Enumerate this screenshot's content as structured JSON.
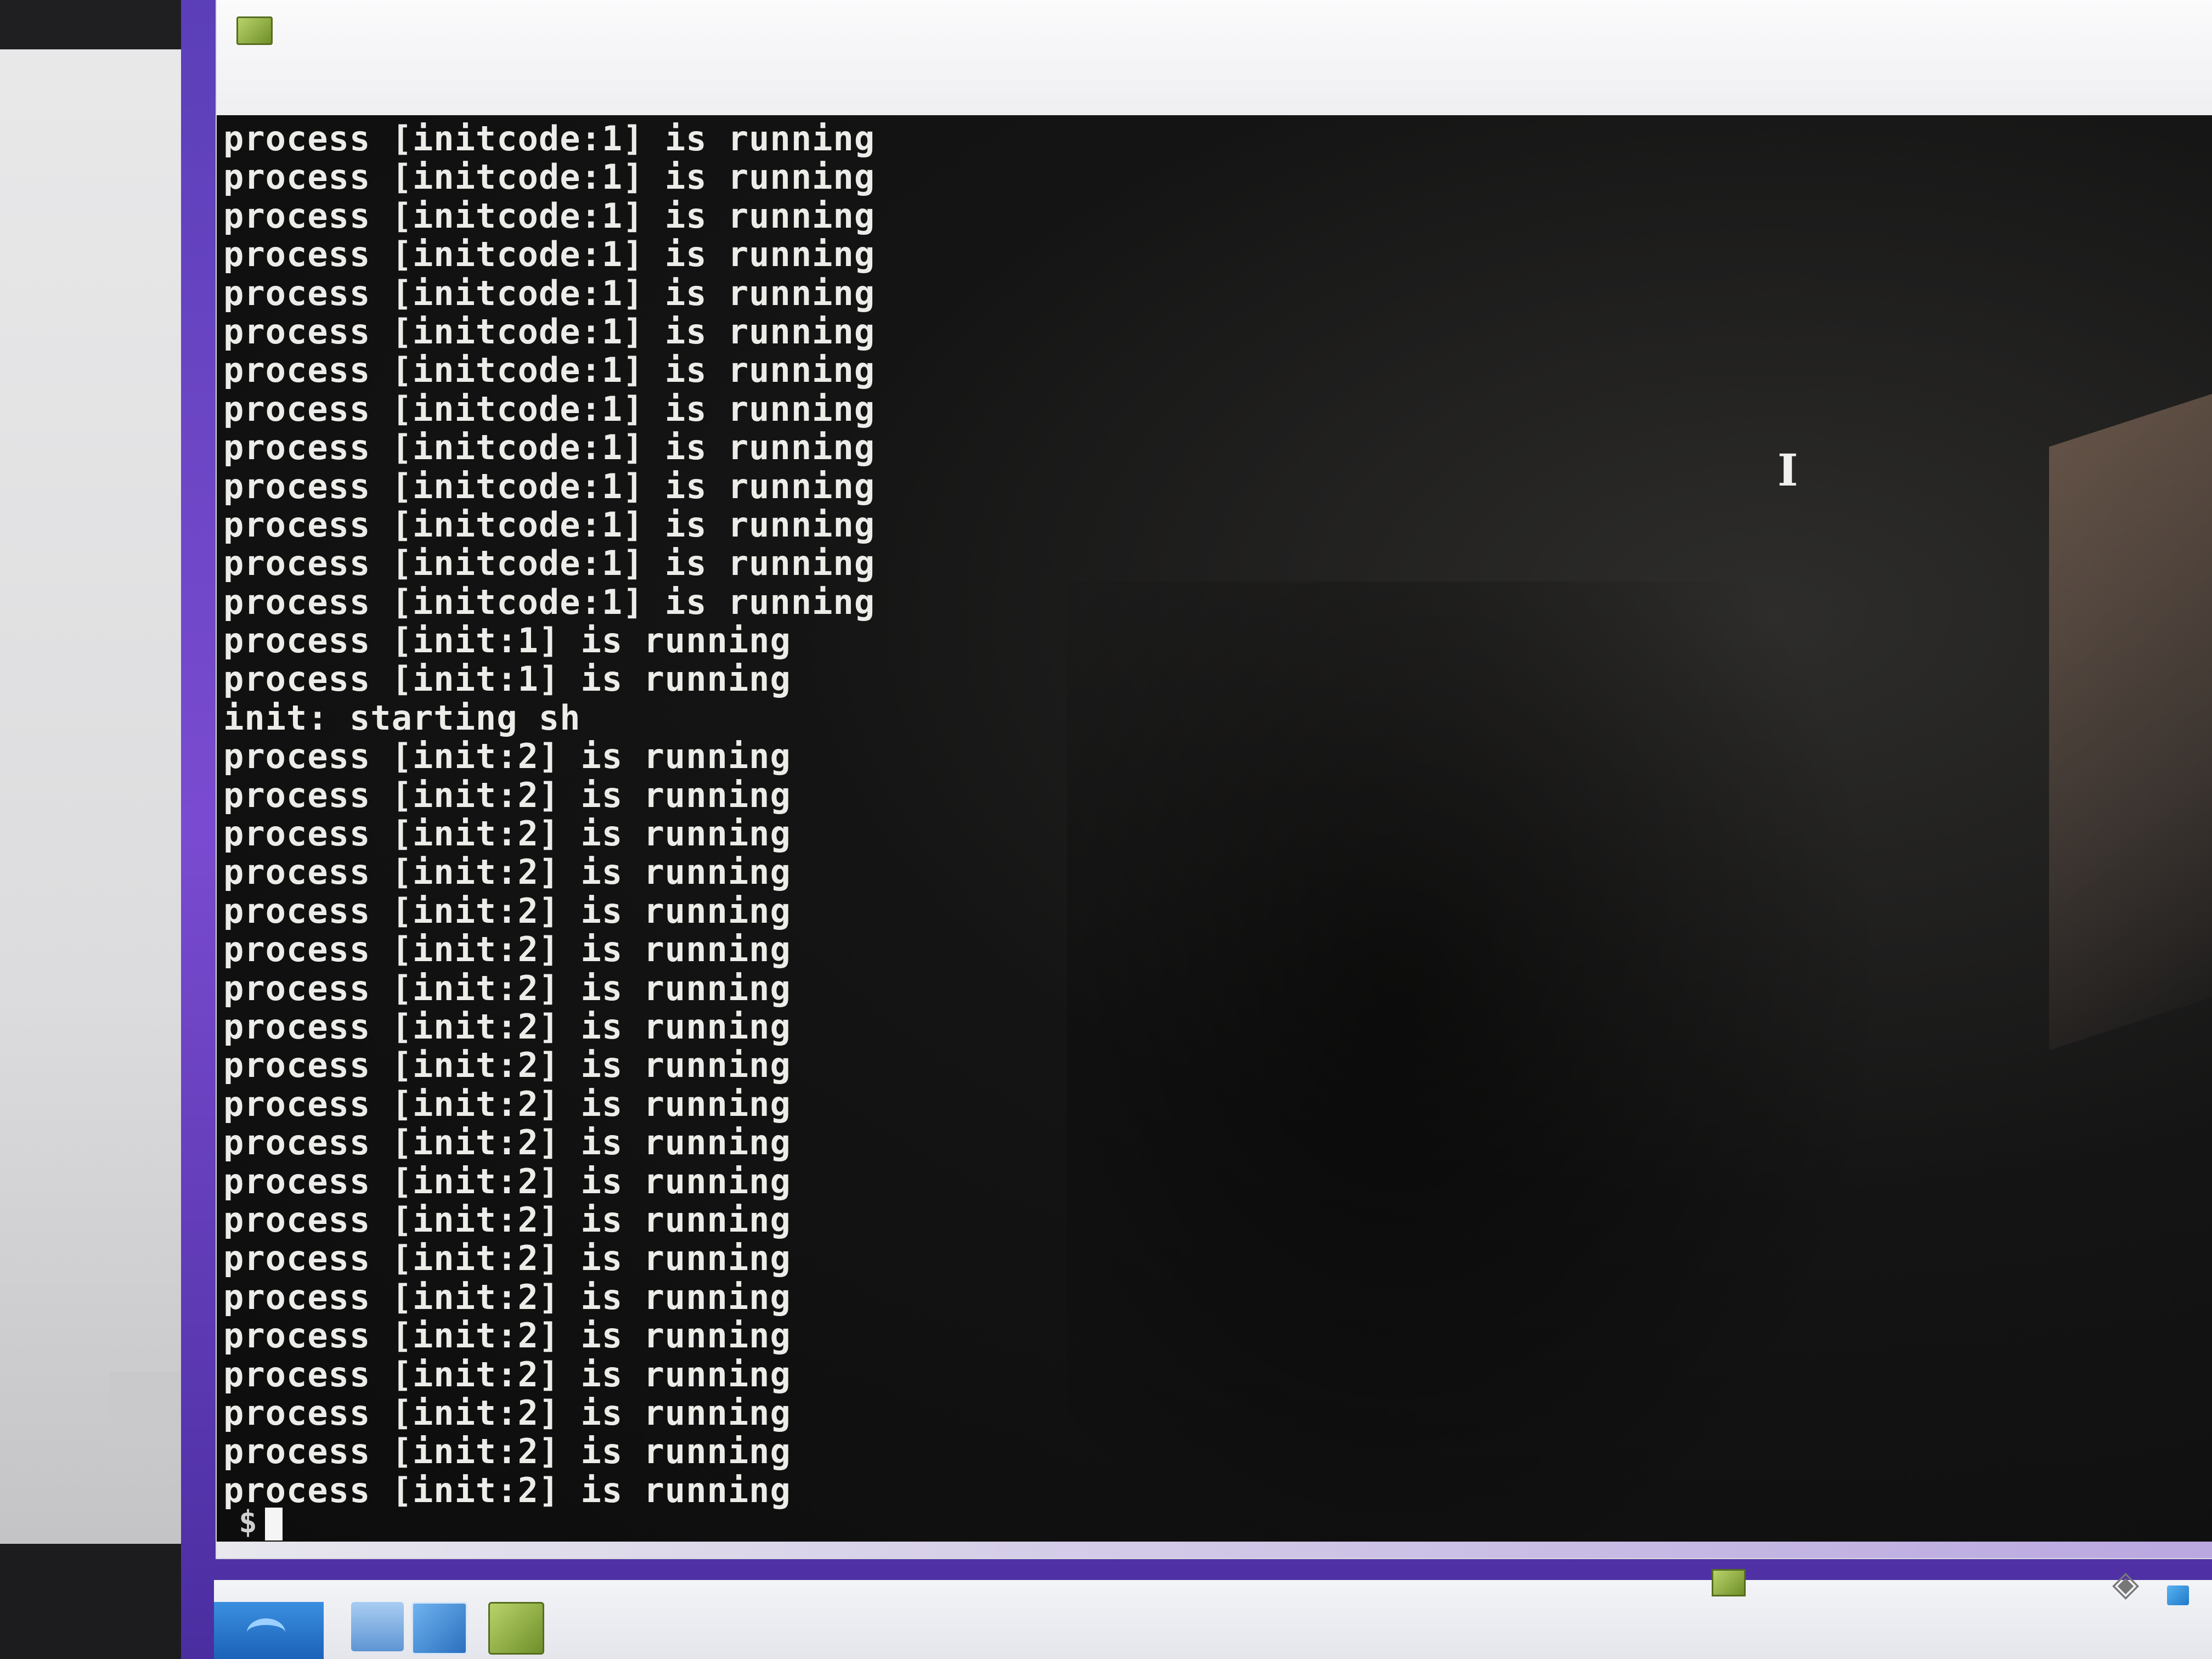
{
  "terminal": {
    "lines": [
      "process [initcode:1] is running",
      "process [initcode:1] is running",
      "process [initcode:1] is running",
      "process [initcode:1] is running",
      "process [initcode:1] is running",
      "process [initcode:1] is running",
      "process [initcode:1] is running",
      "process [initcode:1] is running",
      "process [initcode:1] is running",
      "process [initcode:1] is running",
      "process [initcode:1] is running",
      "process [initcode:1] is running",
      "process [initcode:1] is running",
      "process [init:1] is running",
      "process [init:1] is running",
      "init: starting sh",
      "process [init:2] is running",
      "process [init:2] is running",
      "process [init:2] is running",
      "process [init:2] is running",
      "process [init:2] is running",
      "process [init:2] is running",
      "process [init:2] is running",
      "process [init:2] is running",
      "process [init:2] is running",
      "process [init:2] is running",
      "process [init:2] is running",
      "process [init:2] is running",
      "process [init:2] is running",
      "process [init:2] is running",
      "process [init:2] is running",
      "process [init:2] is running",
      "process [init:2] is running",
      "process [init:2] is running",
      "process [init:2] is running",
      "process [init:2] is running"
    ],
    "prompt": "$",
    "text_color": "#ecece8",
    "background_color": "#0d0d0d"
  },
  "window": {
    "icon": "vm-app-icon"
  },
  "taskbar": {
    "icons": [
      "start-icon",
      "folder-icon",
      "media-player-icon",
      "vm-app-icon"
    ],
    "tray_icons": [
      "vm-app-icon",
      "sound-icon",
      "network-icon"
    ]
  }
}
